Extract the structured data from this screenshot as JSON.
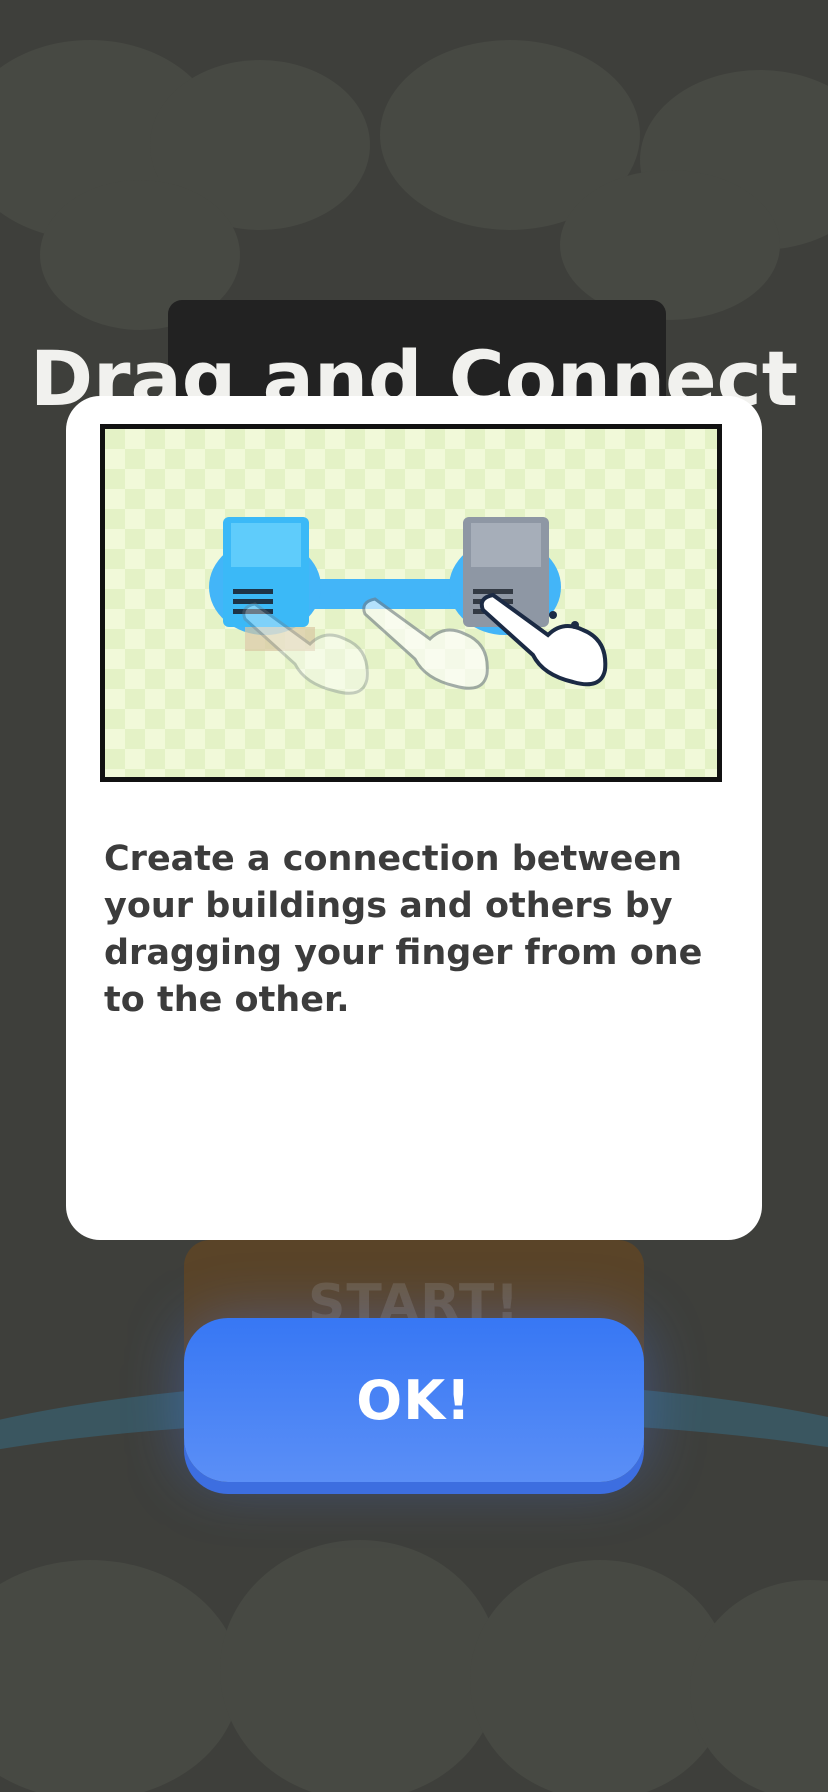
{
  "dialog": {
    "title": "Drag and Connect",
    "description": "Create a connection between your buildings and others by dragging your finger from one to the other.",
    "illustration": {
      "icons": [
        "blue-building-icon",
        "gray-building-icon",
        "pointing-hand-icon"
      ]
    },
    "ok_label": "OK!"
  },
  "background": {
    "start_label": "START!"
  },
  "colors": {
    "overlay": "#3e3f3b",
    "card": "#ffffff",
    "title_text": "#f1f1ee",
    "body_text": "#3c3c3c",
    "ok_button": "#3777f4",
    "player_building": "#3bb9f7",
    "other_building": "#8e97a4",
    "connection_line": "#43b5f8",
    "grid_light": "#f1f9d9",
    "grid_dark": "#e4f2c6"
  }
}
